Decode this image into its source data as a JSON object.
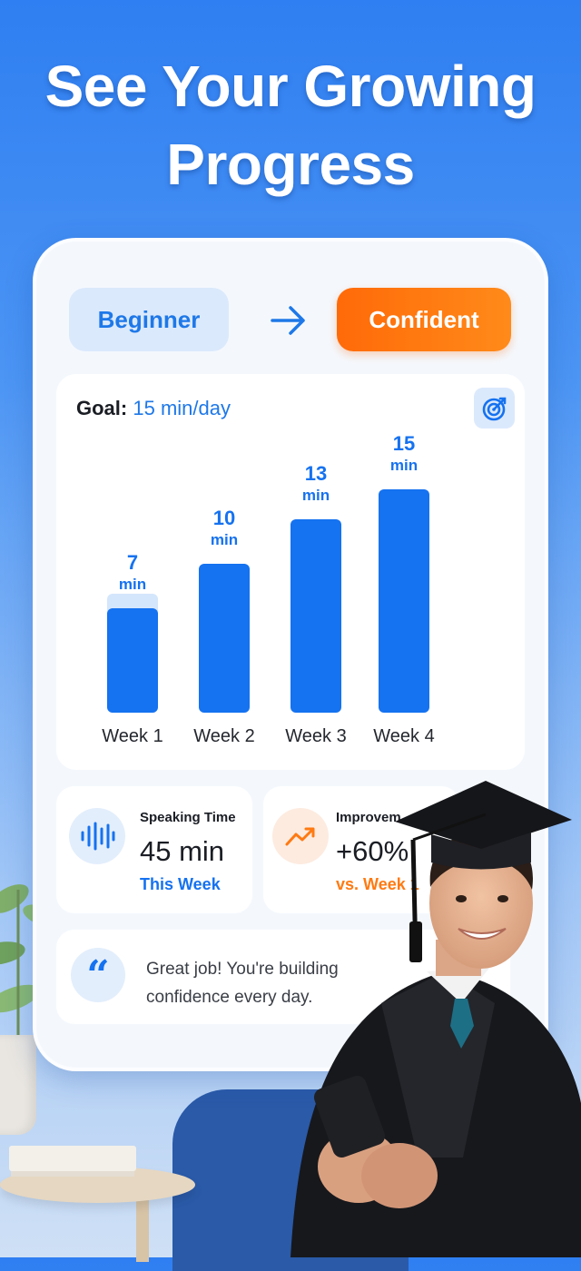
{
  "headline": {
    "line1": "See Your Growing",
    "line2": "Progress"
  },
  "levels": {
    "from": "Beginner",
    "to": "Confident"
  },
  "goal": {
    "label": "Goal:",
    "value": "15 min/day"
  },
  "colors": {
    "accent": "#1572f0",
    "orange": "#ff7a12"
  },
  "chart_data": {
    "type": "bar",
    "categories": [
      "Week 1",
      "Week 2",
      "Week 3",
      "Week 4"
    ],
    "values": [
      7,
      10,
      13,
      15
    ],
    "value_labels": [
      {
        "num": "7",
        "unit": "min"
      },
      {
        "num": "10",
        "unit": "min"
      },
      {
        "num": "13",
        "unit": "min"
      },
      {
        "num": "15",
        "unit": "min"
      }
    ],
    "week1_highlight": 8
  },
  "stats": {
    "speaking": {
      "title": "Speaking Time",
      "value": "45 min",
      "sub": "This Week"
    },
    "improvement": {
      "title": "Improvem",
      "value": "+60%",
      "sub": "vs. Week 1"
    }
  },
  "quote": "Great job! You're building confidence every day."
}
